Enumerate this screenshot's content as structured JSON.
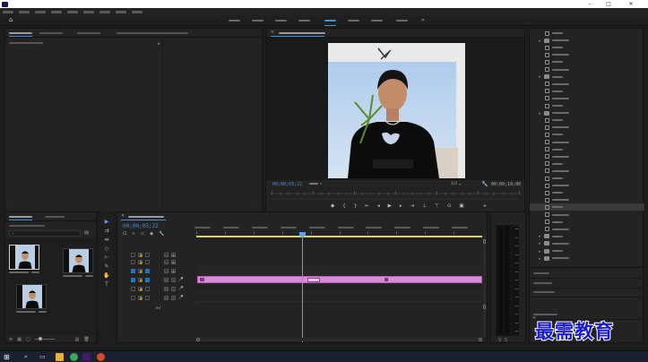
{
  "app": {
    "title": "",
    "window_controls": {
      "minimize": "–",
      "maximize": "□",
      "close": "✕"
    }
  },
  "menu": {
    "items": [
      "",
      "",
      "",
      "",
      "",
      "",
      "",
      "",
      ""
    ]
  },
  "workspaces": {
    "home_icon": "home-icon",
    "tabs": [
      {
        "label": "",
        "active": false
      },
      {
        "label": "",
        "active": false
      },
      {
        "label": "",
        "active": false
      },
      {
        "label": "",
        "active": false
      },
      {
        "label": "",
        "active": true
      },
      {
        "label": "",
        "active": false
      },
      {
        "label": "",
        "active": false
      },
      {
        "label": "",
        "active": false
      }
    ],
    "overflow": "»"
  },
  "source_panel": {
    "tabs": [
      {
        "label": "",
        "active": true
      },
      {
        "label": "",
        "active": false
      },
      {
        "label": "",
        "active": false
      },
      {
        "label": "",
        "active": false
      }
    ],
    "content_label": ""
  },
  "program_monitor": {
    "title": "",
    "current_time": "00;00;03;22",
    "fit": "",
    "resolution": "1/2",
    "duration": "00;00;10;00",
    "playhead_fraction": 0.37
  },
  "project_panel": {
    "tabs": [
      {
        "label": "",
        "active": true
      },
      {
        "label": "",
        "active": false
      }
    ],
    "path_label": "",
    "search_placeholder": "",
    "items": [
      {
        "name": "",
        "duration": "",
        "selected": true
      },
      {
        "name": "",
        "duration": "",
        "selected": false
      },
      {
        "name": "",
        "duration": "",
        "selected": false
      }
    ]
  },
  "timeline": {
    "sequence_name": "",
    "current_time": "00;00;03;22",
    "ruler": [
      "",
      "",
      "",
      "",
      "",
      "",
      "",
      "",
      "",
      ""
    ],
    "video_tracks": [
      "",
      "",
      ""
    ],
    "audio_tracks": [
      "",
      "",
      ""
    ],
    "master_label": "",
    "master_value": "",
    "clip_name": "",
    "effect_label": "",
    "playhead_fraction": 0.37
  },
  "effects_panel": {
    "tree": [
      {
        "label": "",
        "type": "item",
        "depth": 2
      },
      {
        "label": "",
        "type": "folder",
        "depth": 1
      },
      {
        "label": "",
        "type": "item",
        "depth": 2
      },
      {
        "label": "",
        "type": "item",
        "depth": 2
      },
      {
        "label": "",
        "type": "item",
        "depth": 2
      },
      {
        "label": "",
        "type": "item",
        "depth": 2
      },
      {
        "label": "",
        "type": "folder",
        "depth": 1
      },
      {
        "label": "",
        "type": "item",
        "depth": 2
      },
      {
        "label": "",
        "type": "item",
        "depth": 2
      },
      {
        "label": "",
        "type": "item",
        "depth": 2
      },
      {
        "label": "",
        "type": "item",
        "depth": 2
      },
      {
        "label": "",
        "type": "folder",
        "depth": 1
      },
      {
        "label": "",
        "type": "item",
        "depth": 2
      },
      {
        "label": "",
        "type": "item",
        "depth": 2
      },
      {
        "label": "",
        "type": "item",
        "depth": 2
      },
      {
        "label": "",
        "type": "item",
        "depth": 2
      },
      {
        "label": "",
        "type": "item",
        "depth": 2
      },
      {
        "label": "",
        "type": "item",
        "depth": 2
      },
      {
        "label": "",
        "type": "item",
        "depth": 2
      },
      {
        "label": "",
        "type": "item",
        "depth": 2
      },
      {
        "label": "",
        "type": "item",
        "depth": 2
      },
      {
        "label": "",
        "type": "item",
        "depth": 2
      },
      {
        "label": "",
        "type": "item",
        "depth": 2
      },
      {
        "label": "",
        "type": "item",
        "depth": 2
      },
      {
        "label": "",
        "type": "item",
        "depth": 2,
        "selected": true
      },
      {
        "label": "",
        "type": "item",
        "depth": 2
      },
      {
        "label": "",
        "type": "item",
        "depth": 2
      },
      {
        "label": "",
        "type": "item",
        "depth": 2
      },
      {
        "label": "",
        "type": "folder",
        "depth": 1
      },
      {
        "label": "",
        "type": "folder",
        "depth": 1
      },
      {
        "label": "",
        "type": "folder",
        "depth": 1
      },
      {
        "label": "",
        "type": "folder",
        "depth": 1
      }
    ],
    "sections": [
      "",
      "",
      "",
      ""
    ]
  },
  "taskbar": {
    "start_icon": "windows-icon",
    "time": "",
    "date": ""
  },
  "watermark": {
    "main": "最需教育",
    "sub": ""
  },
  "colors": {
    "accent": "#4d8fd6",
    "clip": "#d98ad8",
    "playhead": "#5aa0ff",
    "work_area": "#d9d36a",
    "watermark": "#1c1cc8"
  }
}
